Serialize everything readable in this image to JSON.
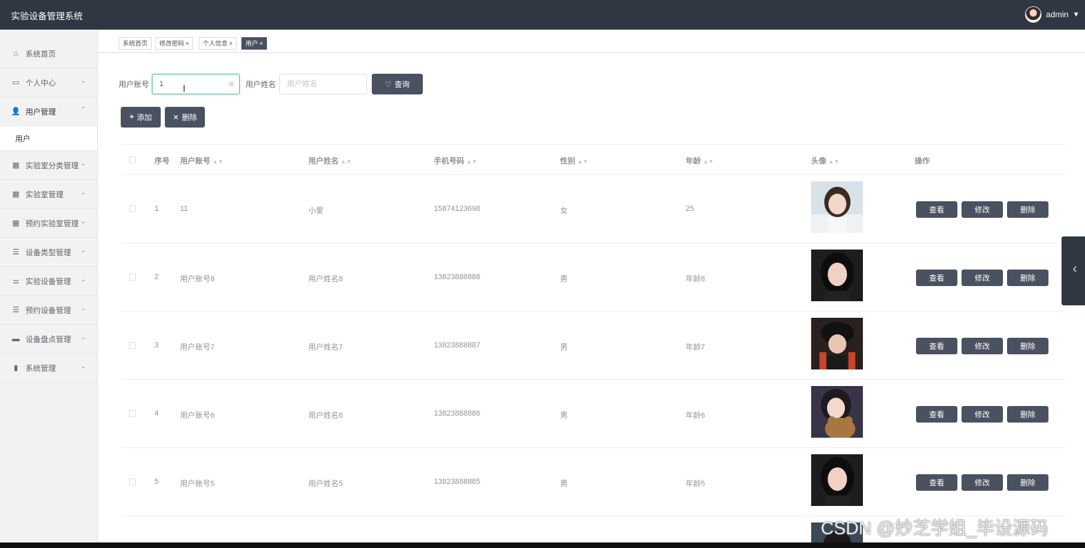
{
  "app": {
    "title": "实验设备管理系统",
    "user": "admin"
  },
  "sidebar": {
    "items": [
      {
        "label": "系统首页",
        "icon": "home-icon"
      },
      {
        "label": "个人中心",
        "icon": "calendar-icon"
      },
      {
        "label": "用户管理",
        "icon": "user-icon"
      },
      {
        "label": "实验室分类管理",
        "icon": "grid-icon"
      },
      {
        "label": "实验室管理",
        "icon": "grid-dots-icon"
      },
      {
        "label": "预约实验室管理",
        "icon": "grid-icon"
      },
      {
        "label": "设备类型管理",
        "icon": "list-icon"
      },
      {
        "label": "实验设备管理",
        "icon": "sliders-icon"
      },
      {
        "label": "预约设备管理",
        "icon": "list-icon"
      },
      {
        "label": "设备盘点管理",
        "icon": "box-icon"
      },
      {
        "label": "系统管理",
        "icon": "chart-icon"
      }
    ],
    "sub_items": [
      {
        "label": "用户"
      }
    ]
  },
  "tags": [
    {
      "label": "系统首页"
    },
    {
      "label": "修改密码"
    },
    {
      "label": "个人信息"
    },
    {
      "label": "用户"
    }
  ],
  "search": {
    "account_label": "用户账号",
    "account_value": "1",
    "name_label": "用户姓名",
    "name_placeholder": "用户姓名",
    "query_button": "查询"
  },
  "actions": {
    "add": "添加",
    "delete": "删除"
  },
  "table": {
    "headers": [
      "序号",
      "用户账号",
      "用户姓名",
      "手机号码",
      "性别",
      "年龄",
      "头像",
      "操作"
    ],
    "rows": [
      {
        "index": "1",
        "account": "11",
        "name": "小爱",
        "phone": "15874123698",
        "gender": "女",
        "age": "25"
      },
      {
        "index": "2",
        "account": "用户账号8",
        "name": "用户姓名8",
        "phone": "13823888888",
        "gender": "男",
        "age": "年龄8"
      },
      {
        "index": "3",
        "account": "用户账号7",
        "name": "用户姓名7",
        "phone": "13823888887",
        "gender": "男",
        "age": "年龄7"
      },
      {
        "index": "4",
        "account": "用户账号6",
        "name": "用户姓名6",
        "phone": "13823888886",
        "gender": "男",
        "age": "年龄6"
      },
      {
        "index": "5",
        "account": "用户账号5",
        "name": "用户姓名5",
        "phone": "13823888885",
        "gender": "男",
        "age": "年龄5"
      }
    ],
    "row_actions": {
      "view": "查看",
      "edit": "修改",
      "delete": "删除"
    }
  },
  "watermark": "CSDN @妙芝学姐_毕设源码"
}
